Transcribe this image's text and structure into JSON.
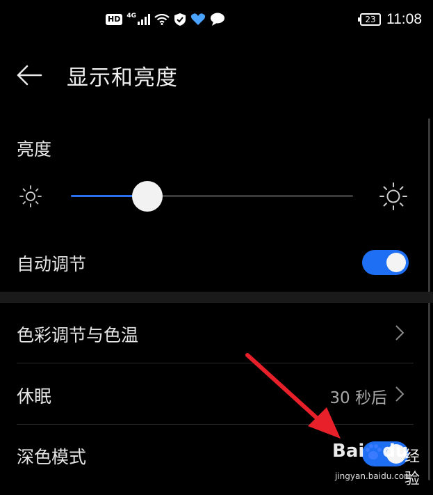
{
  "status_bar": {
    "hd": "HD",
    "network": "4G",
    "battery": "23",
    "time": "11:08",
    "icons": [
      "signal-icon",
      "wifi-icon",
      "shield-icon",
      "heart-icon",
      "message-icon"
    ]
  },
  "header": {
    "back_icon": "back-arrow-icon",
    "title": "显示和亮度"
  },
  "brightness": {
    "label": "亮度",
    "level": 0.27,
    "auto_label": "自动调节",
    "auto_enabled": true
  },
  "rows": {
    "color": {
      "label": "色彩调节与色温"
    },
    "sleep": {
      "label": "休眠",
      "value": "30 秒后"
    },
    "dark": {
      "label": "深色模式",
      "enabled": true
    }
  },
  "watermark": {
    "logo": "Bai",
    "logo_suffix": "du",
    "cn": "经验",
    "url": "jingyan.baidu.com"
  },
  "colors": {
    "accent": "#1f6ff5",
    "annotation_arrow": "#e8202a",
    "background": "#000000"
  }
}
